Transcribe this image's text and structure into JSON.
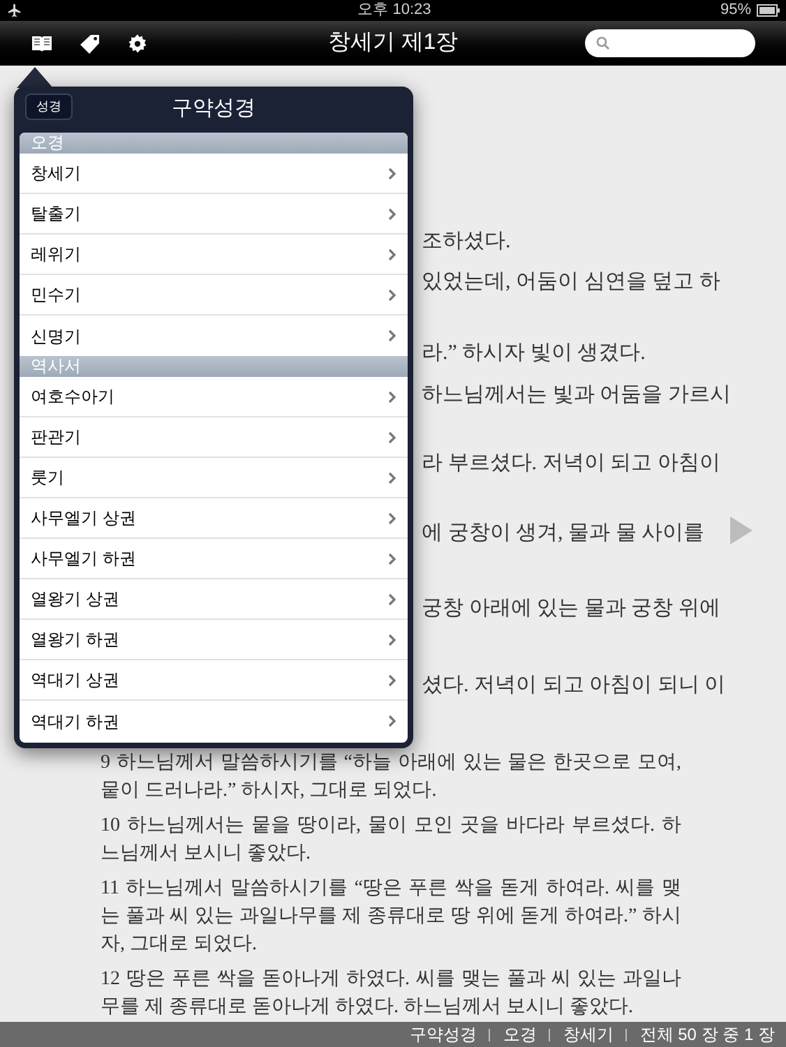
{
  "status_bar": {
    "time": "오후 10:23",
    "battery": "95%"
  },
  "toolbar": {
    "title": "창세기 제1장"
  },
  "popover": {
    "title": "구약성경",
    "back_button": "성경",
    "sections": [
      {
        "title": "오경",
        "items": [
          {
            "label": "창세기"
          },
          {
            "label": "탈출기"
          },
          {
            "label": "레위기"
          },
          {
            "label": "민수기"
          },
          {
            "label": "신명기"
          }
        ]
      },
      {
        "title": "역사서",
        "items": [
          {
            "label": "여호수아기"
          },
          {
            "label": "판관기"
          },
          {
            "label": "룻기"
          },
          {
            "label": "사무엘기 상권"
          },
          {
            "label": "사무엘기 하권"
          },
          {
            "label": "열왕기 상권"
          },
          {
            "label": "열왕기 하권"
          },
          {
            "label": "역대기 상권"
          },
          {
            "label": "역대기 하권"
          }
        ]
      }
    ]
  },
  "covered_lines": [
    "조하셨다.",
    "있었는데, 어둠이 심연을 덮고 하",
    "라.” 하시자 빛이 생겼다.",
    "하느님께서는 빛과 어둠을 가르시",
    "라 부르셨다. 저녁이 되고 아침이",
    "에 궁창이 생겨, 물과 물 사이를",
    "궁창 아래에 있는 물과 궁창 위에",
    "셨다. 저녁이 되고 아침이 되니 이"
  ],
  "verses": [
    "9 하느님께서 말씀하시기를 “하늘 아래에 있는 물은 한곳으로 모여, 뭍이 드러나라.” 하시자, 그대로 되었다.",
    "10 하느님께서는 뭍을 땅이라, 물이 모인 곳을 바다라 부르셨다. 하느님께서 보시니 좋았다.",
    "11 하느님께서 말씀하시기를 “땅은 푸른 싹을 돋게 하여라. 씨를 맺는 풀과 씨 있는 과일나무를 제 종류대로 땅 위에 돋게 하여라.” 하시자, 그대로 되었다.",
    "12 땅은 푸른 싹을 돋아나게 하였다. 씨를 맺는 풀과 씨 있는 과일나무를 제 종류대로 돋아나게 하였다. 하느님께서 보시니 좋았다."
  ],
  "footer": [
    "구약성경",
    "오경",
    "창세기",
    "전체 50 장 중 1 장"
  ]
}
